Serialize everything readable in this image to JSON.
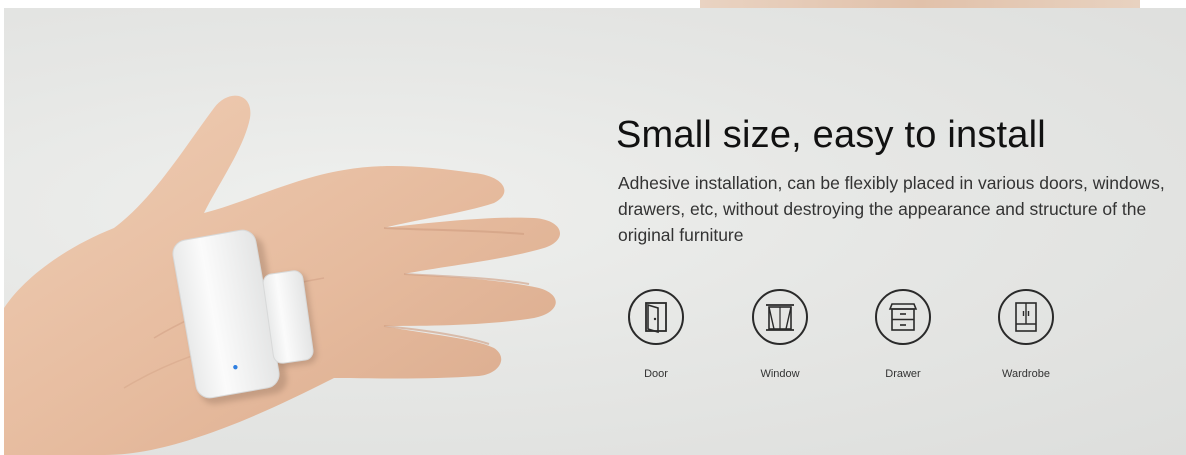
{
  "headline": "Small size, easy to install",
  "description": "Adhesive installation, can be flexibly placed in various doors, windows, drawers, etc, without destroying the appearance and structure of the original furniture",
  "applications": [
    {
      "label": "Door",
      "icon": "door-icon"
    },
    {
      "label": "Window",
      "icon": "window-icon"
    },
    {
      "label": "Drawer",
      "icon": "drawer-icon"
    },
    {
      "label": "Wardrobe",
      "icon": "wardrobe-icon"
    }
  ],
  "colors": {
    "background": "#e6e7e5",
    "headline": "#111111",
    "body_text": "#333333",
    "icon_stroke": "#2a2a2a",
    "skin": "#e8bfa3",
    "sensor": "#f6f6f6",
    "led": "#2f7fe0"
  }
}
